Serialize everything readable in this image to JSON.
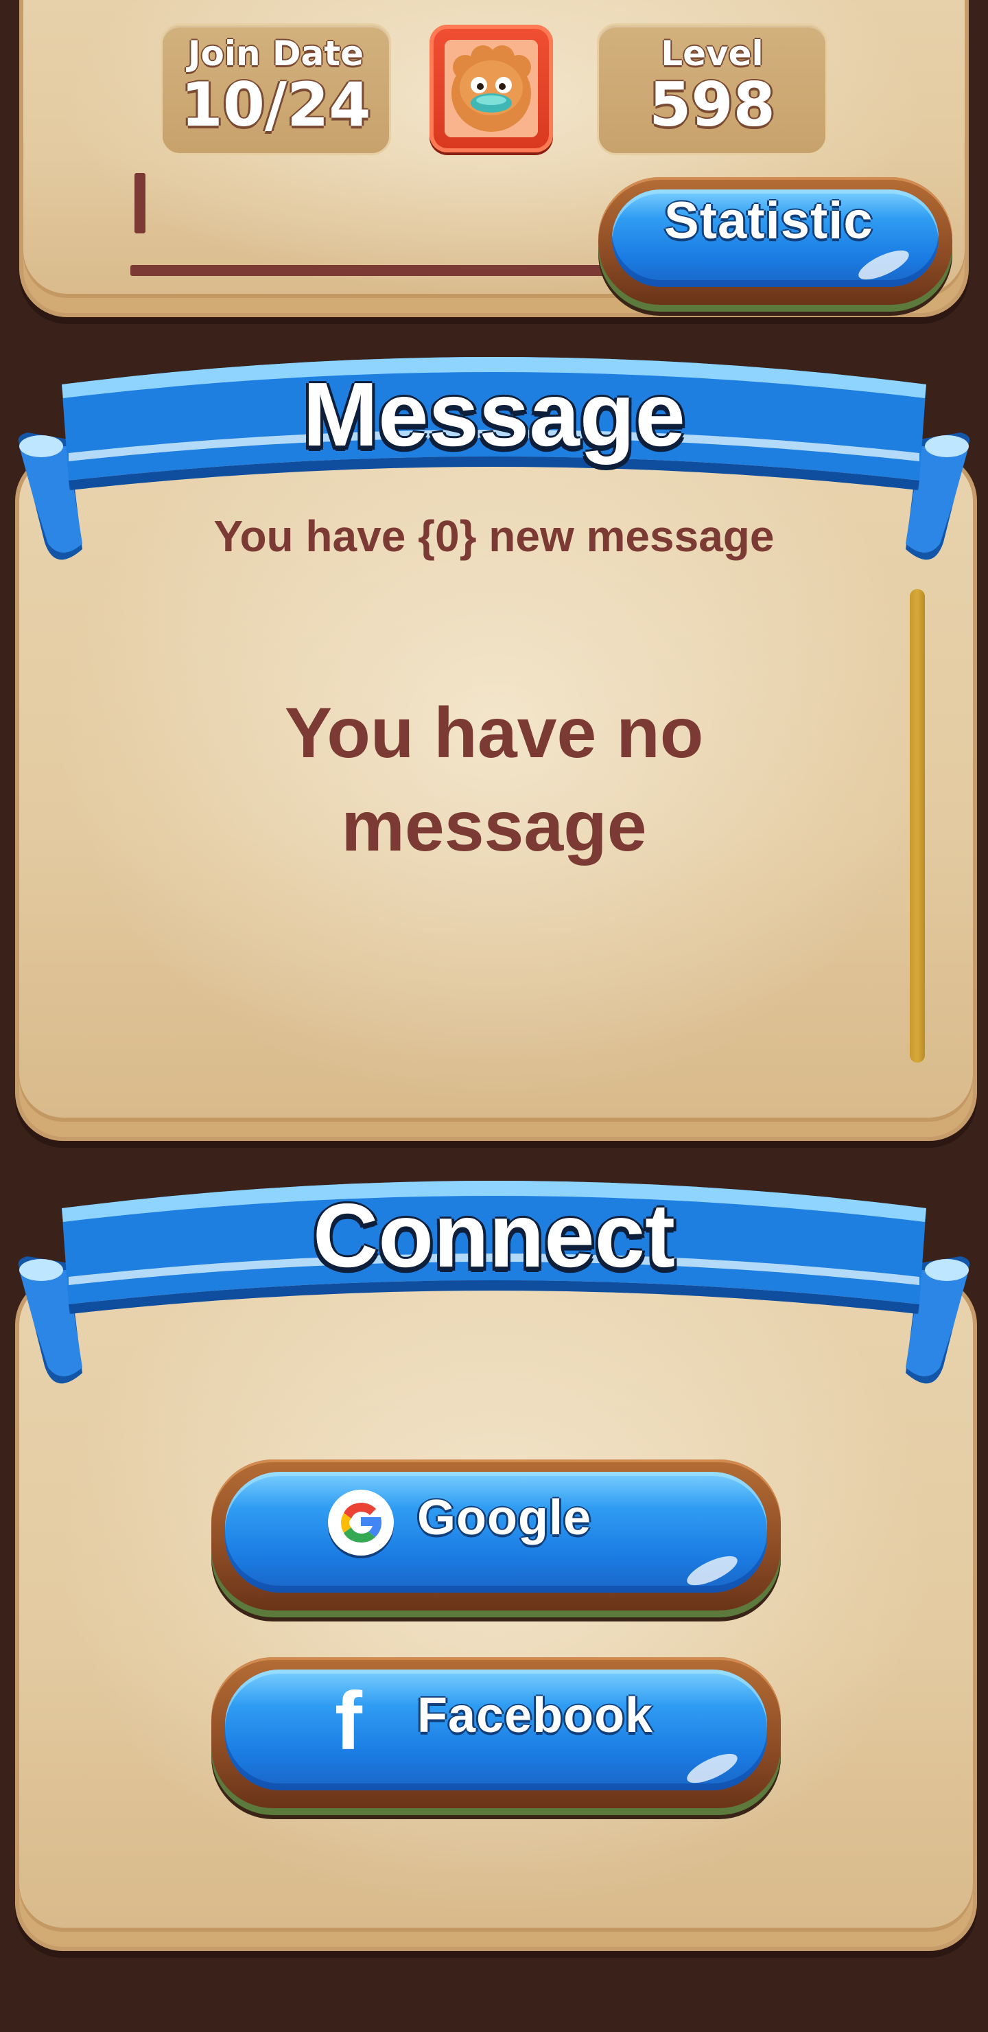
{
  "profile": {
    "join_date_label": "Join Date",
    "join_date_value": "10/24",
    "level_label": "Level",
    "level_value": "598",
    "avatar": "puffy-character-avatar",
    "statistic_button_label": "Statistic"
  },
  "message": {
    "title": "Message",
    "count_text": "You have {0} new message",
    "empty_text": "You have no message"
  },
  "connect": {
    "title": "Connect",
    "google_label": "Google",
    "facebook_label": "Facebook"
  },
  "colors": {
    "background": "#3a221b",
    "panel": "#e3caa0",
    "ribbon_blue": "#1f7fe0",
    "text_brown": "#7b3a33",
    "avatar_frame": "#e8452a",
    "scrollbar": "#c79a2d"
  },
  "icons": {
    "google": "google-g-icon",
    "facebook": "facebook-f-icon"
  }
}
